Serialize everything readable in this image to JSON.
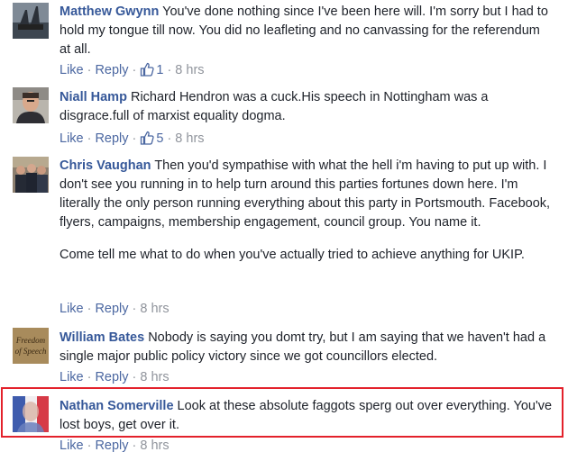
{
  "comments": [
    {
      "author": "Matthew Gwynn",
      "text": "You've done nothing since I've been here will. I'm sorry but I had to hold my tongue till now. You did no leafleting and no canvassing for the referendum at all.",
      "like_label": "Like",
      "reply_label": "Reply",
      "likes": "1",
      "time": "8 hrs"
    },
    {
      "author": "Niall Hamp",
      "text": "Richard Hendron was a cuck.His speech in Nottingham was a disgrace.full of marxist equality dogma.",
      "like_label": "Like",
      "reply_label": "Reply",
      "likes": "5",
      "time": "8 hrs"
    },
    {
      "author": "Chris Vaughan",
      "text": "Then you'd sympathise with what the hell i'm having to put up with. I don't see you running in to help turn around this parties fortunes down here. I'm literally the only person running everything about this party in Portsmouth. Facebook, flyers, campaigns, membership engagement, council group. You name it.",
      "text2": "Come tell me what to do when you've actually tried to achieve anything for UKIP.",
      "like_label": "Like",
      "reply_label": "Reply",
      "time": "8 hrs"
    },
    {
      "author": "William Bates",
      "avatar_text": "Freedom of Speech",
      "text": "Nobody is saying you domt try, but I am saying that we haven't had a single major public policy victory since we got councillors elected.",
      "like_label": "Like",
      "reply_label": "Reply",
      "time": "8 hrs"
    },
    {
      "author": "Nathan Somerville",
      "text": "Look at these absolute faggots sperg out over everything. You've lost boys, get over it.",
      "like_label": "Like",
      "reply_label": "Reply",
      "time": "8 hrs"
    }
  ],
  "colors": {
    "author": "#365899",
    "link": "#4b67a1",
    "meta": "#90949c",
    "highlight": "#e3212b"
  }
}
